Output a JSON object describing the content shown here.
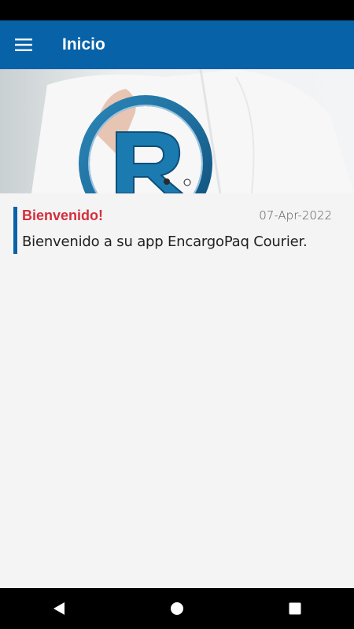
{
  "app_bar": {
    "title": "Inicio",
    "menu_icon": "hamburger-menu-icon",
    "background": "#0862a8"
  },
  "hero": {
    "image": "registered-trademark-symbol-in-hand"
  },
  "news": [
    {
      "title": "Bienvenido!",
      "date": "07-Apr-2022",
      "body": "Bienvenido a su app EncargoPaq Courier."
    }
  ],
  "colors": {
    "primary": "#0862a8",
    "title_accent": "#d32f3c",
    "background": "#f4f4f4"
  },
  "nav_bar": {
    "back_icon": "back-triangle-icon",
    "home_icon": "home-circle-icon",
    "recents_icon": "recents-square-icon"
  }
}
